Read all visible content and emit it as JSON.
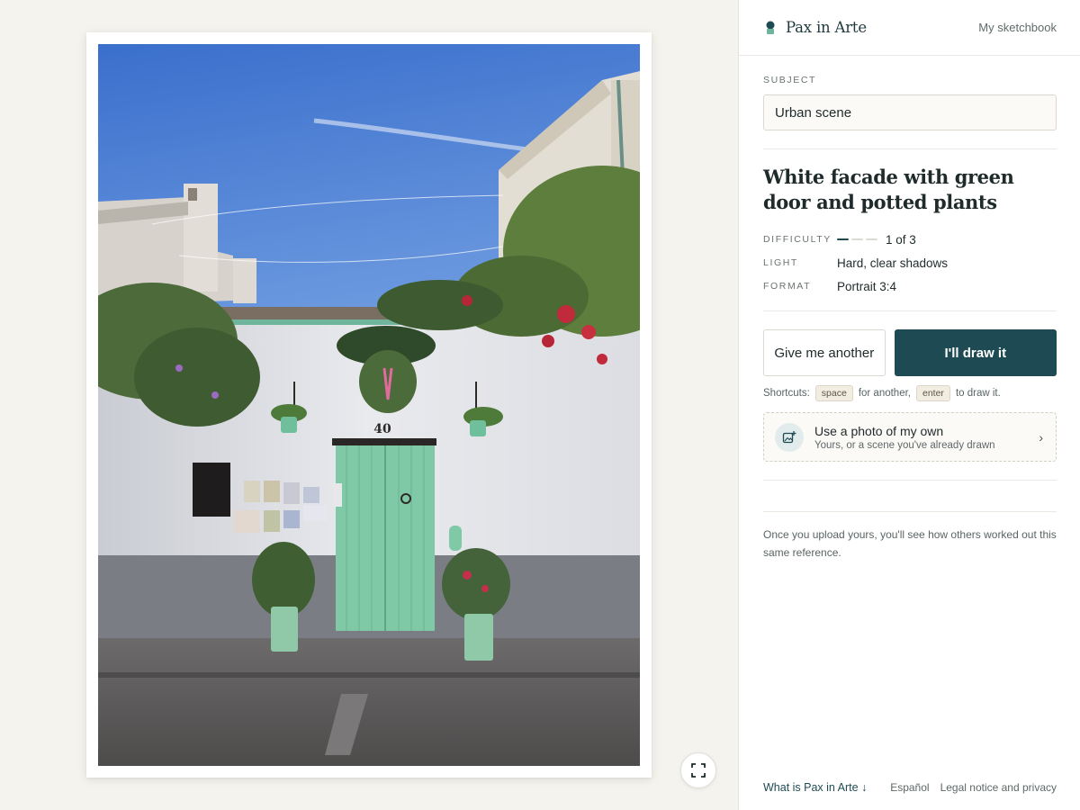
{
  "brand": {
    "name": "Pax in Arte",
    "sketchbook_link": "My sketchbook"
  },
  "subject": {
    "label": "SUBJECT",
    "value": "Urban scene"
  },
  "reference": {
    "title": "White facade with green door and potted plants",
    "house_number": "40",
    "difficulty": {
      "label": "DIFFICULTY",
      "level": 1,
      "max": 3,
      "text": "1 of 3"
    },
    "light": {
      "label": "LIGHT",
      "value": "Hard, clear shadows"
    },
    "format": {
      "label": "FORMAT",
      "value": "Portrait 3:4"
    }
  },
  "actions": {
    "another_label": "Give me another",
    "draw_label": "I'll draw it"
  },
  "shortcuts": {
    "prefix": "Shortcuts:",
    "key1": "space",
    "text1": "for another,",
    "key2": "enter",
    "text2": "to draw it."
  },
  "upload": {
    "title": "Use a photo of my own",
    "subtitle": "Yours, or a scene you've already drawn",
    "chevron": "›"
  },
  "note": "Once you upload yours, you'll see how others worked out this same reference.",
  "footer": {
    "what_link": "What is Pax in Arte ↓",
    "language": "Español",
    "legal": "Legal notice and privacy"
  },
  "icons": {
    "brand": "brand-mark-icon",
    "expand": "expand-icon",
    "upload": "add-photo-icon",
    "chevron": "chevron-right-icon"
  },
  "colors": {
    "accent": "#1e4b53",
    "door": "#7fc9a6",
    "sky": "#4a7bd0"
  }
}
